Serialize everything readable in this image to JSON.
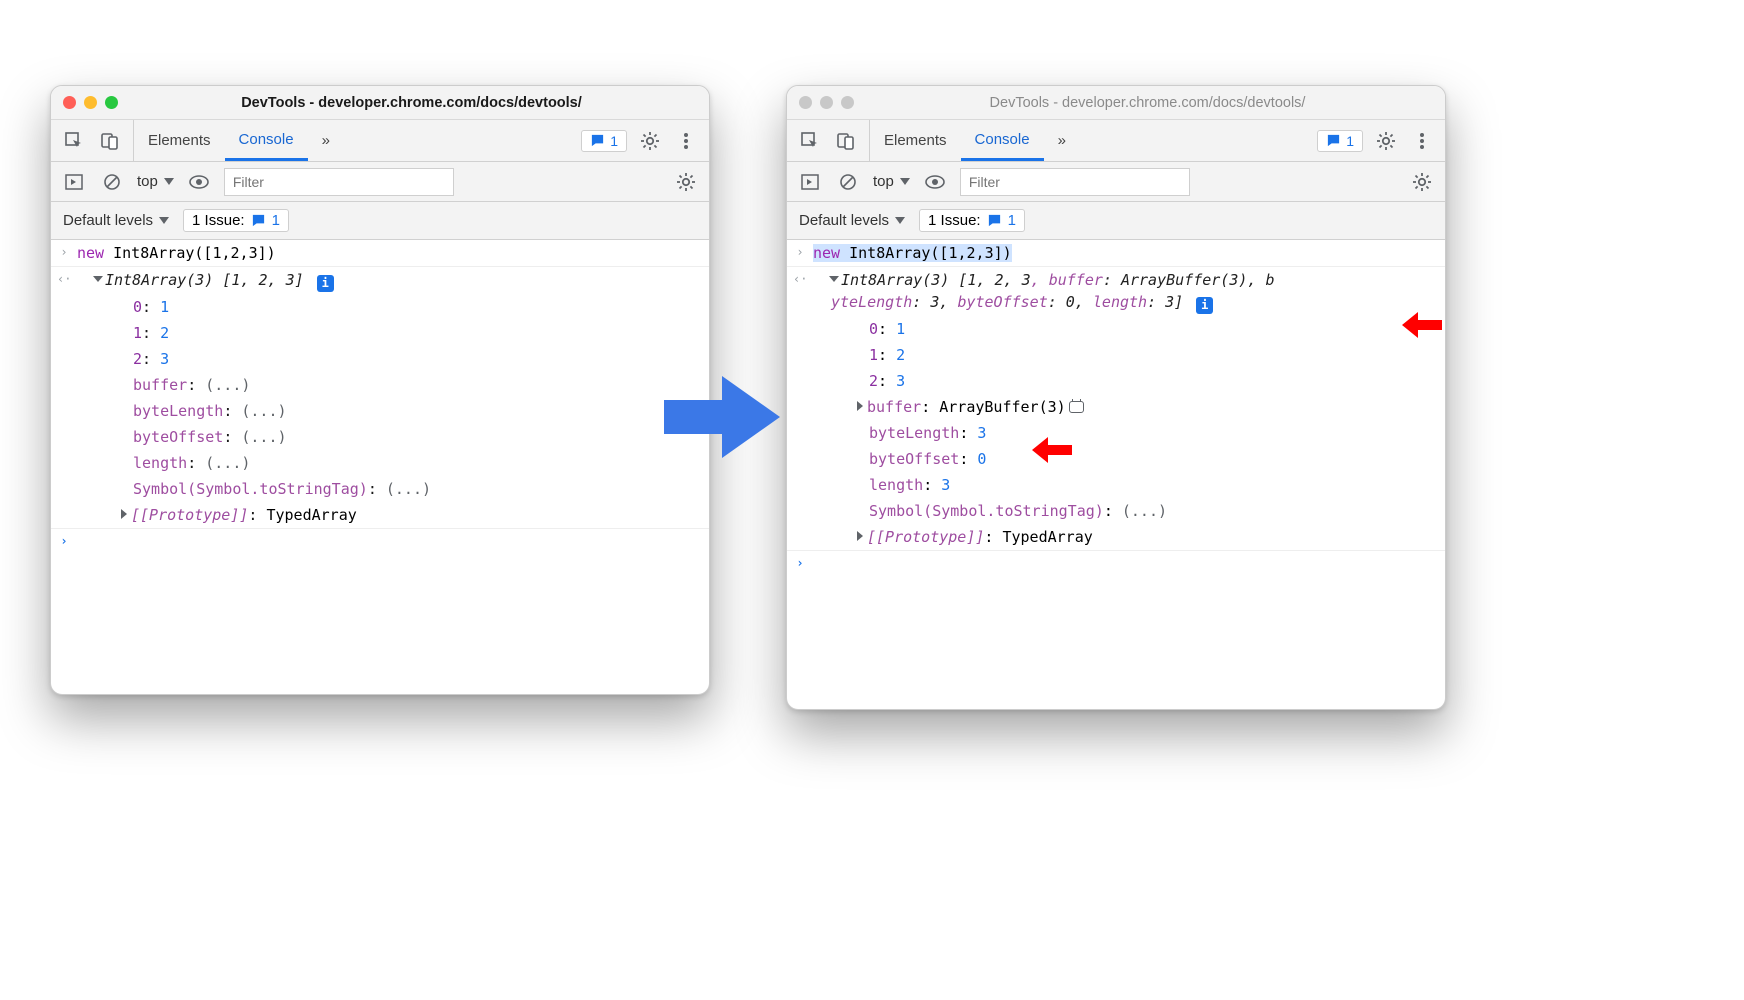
{
  "window": {
    "title": "DevTools - developer.chrome.com/docs/devtools/",
    "tabs": {
      "elements": "Elements",
      "console": "Console"
    },
    "msg_count": "1",
    "filter": {
      "context": "top",
      "placeholder": "Filter",
      "levels": "Default levels",
      "issue_label": "1 Issue:",
      "issue_count": "1"
    }
  },
  "left": {
    "input_kw": "new",
    "input_call": " Int8Array([1,2,3])",
    "summary_type": "Int8Array(3) ",
    "summary_vals": "[1, 2, 3]",
    "rows": {
      "i0k": "0",
      "i0v": "1",
      "i1k": "1",
      "i1v": "2",
      "i2k": "2",
      "i2v": "3",
      "p_buffer": "buffer",
      "p_byteLength": "byteLength",
      "p_byteOffset": "byteOffset",
      "p_length": "length",
      "lazy": "(...)",
      "p_sym": "Symbol(Symbol.toStringTag)",
      "proto_k": "[[Prototype]]",
      "proto_v": "TypedArray"
    }
  },
  "right": {
    "input_kw": "new",
    "input_call": " Int8Array([1,2,3])",
    "summary_line1_a": "Int8Array(3) [",
    "summary_line1_b": "1, 2, 3",
    "summary_line1_c": ", buffer",
    "summary_line1_d": ": ArrayBuffer(3), b",
    "summary_line2_a": "yteLength",
    "summary_line2_b": ": 3, ",
    "summary_line2_c": "byteOffset",
    "summary_line2_d": ": 0, ",
    "summary_line2_e": "length",
    "summary_line2_f": ": 3]",
    "rows": {
      "i0k": "0",
      "i0v": "1",
      "i1k": "1",
      "i1v": "2",
      "i2k": "2",
      "i2v": "3",
      "p_buffer": "buffer",
      "v_buffer": "ArrayBuffer(3)",
      "p_byteLength": "byteLength",
      "v_byteLength": "3",
      "p_byteOffset": "byteOffset",
      "v_byteOffset": "0",
      "p_length": "length",
      "v_length": "3",
      "p_sym": "Symbol(Symbol.toStringTag)",
      "v_sym": "(...)",
      "proto_k": "[[Prototype]]",
      "proto_v": "TypedArray"
    }
  }
}
